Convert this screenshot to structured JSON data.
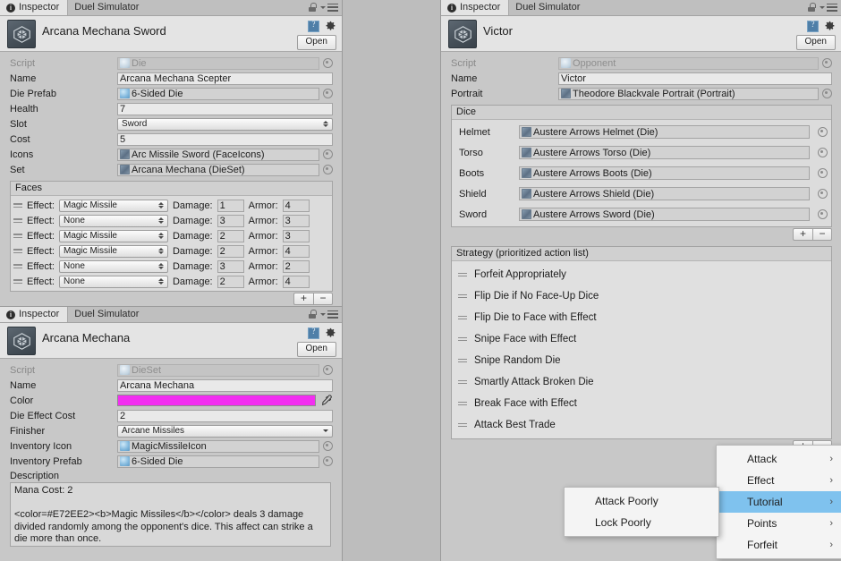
{
  "tabs": {
    "inspector": "Inspector",
    "duel_simulator": "Duel Simulator"
  },
  "common": {
    "open_label": "Open",
    "plus": "+",
    "minus": "−",
    "submenu_arrow": "›"
  },
  "panel_die": {
    "object_name": "Arcana Mechana Sword",
    "fields": [
      {
        "label": "Script",
        "value": "Die",
        "type": "object-disabled",
        "icon": "script-icon"
      },
      {
        "label": "Name",
        "value": "Arcana Mechana Scepter",
        "type": "text"
      },
      {
        "label": "Die Prefab",
        "value": "6-Sided Die",
        "type": "object",
        "icon": "die-icon"
      },
      {
        "label": "Health",
        "value": "7",
        "type": "text"
      },
      {
        "label": "Slot",
        "value": "Sword",
        "type": "enum"
      },
      {
        "label": "Cost",
        "value": "5",
        "type": "text"
      },
      {
        "label": "Icons",
        "value": "Arc Missile Sword (FaceIcons)",
        "type": "object",
        "icon": "texture-icon"
      },
      {
        "label": "Set",
        "value": "Arcana Mechana (DieSet)",
        "type": "object",
        "icon": "texture-icon"
      }
    ],
    "faces": {
      "title": "Faces",
      "col_effect": "Effect:",
      "col_damage": "Damage:",
      "col_armor": "Armor:",
      "rows": [
        {
          "effect": "Magic Missile",
          "damage": "1",
          "armor": "4"
        },
        {
          "effect": "None",
          "damage": "3",
          "armor": "3"
        },
        {
          "effect": "Magic Missile",
          "damage": "2",
          "armor": "3"
        },
        {
          "effect": "Magic Missile",
          "damage": "2",
          "armor": "4"
        },
        {
          "effect": "None",
          "damage": "3",
          "armor": "2"
        },
        {
          "effect": "None",
          "damage": "2",
          "armor": "4"
        }
      ]
    }
  },
  "panel_dieset": {
    "object_name": "Arcana Mechana",
    "fields": [
      {
        "label": "Script",
        "value": "DieSet",
        "type": "object-disabled",
        "icon": "script-icon"
      },
      {
        "label": "Name",
        "value": "Arcana Mechana",
        "type": "text"
      },
      {
        "label": "Color",
        "value": "#F22EF0",
        "type": "color"
      },
      {
        "label": "Die Effect Cost",
        "value": "2",
        "type": "text"
      },
      {
        "label": "Finisher",
        "value": "Arcane Missiles",
        "type": "dropdown"
      },
      {
        "label": "Inventory Icon",
        "value": "MagicMissileIcon",
        "type": "object",
        "icon": "die-icon"
      },
      {
        "label": "Inventory Prefab",
        "value": "6-Sided Die",
        "type": "object",
        "icon": "die-icon"
      }
    ],
    "description_label": "Description",
    "description_text": "Mana Cost: 2\n\n<color=#E72EE2><b>Magic Missiles</b></color> deals 3 damage divided randomly among the opponent's dice. This affect can strike a die more than once."
  },
  "panel_opponent": {
    "object_name": "Victor",
    "fields": [
      {
        "label": "Script",
        "value": "Opponent",
        "type": "object-disabled",
        "icon": "script-icon"
      },
      {
        "label": "Name",
        "value": "Victor",
        "type": "text"
      },
      {
        "label": "Portrait",
        "value": "Theodore Blackvale Portrait (Portrait)",
        "type": "object",
        "icon": "texture-icon"
      }
    ],
    "dice": {
      "title": "Dice",
      "rows": [
        {
          "label": "Helmet",
          "value": "Austere Arrows Helmet (Die)"
        },
        {
          "label": "Torso",
          "value": "Austere Arrows Torso (Die)"
        },
        {
          "label": "Boots",
          "value": "Austere Arrows Boots (Die)"
        },
        {
          "label": "Shield",
          "value": "Austere Arrows Shield (Die)"
        },
        {
          "label": "Sword",
          "value": "Austere Arrows Sword (Die)"
        }
      ]
    },
    "strategy": {
      "title": "Strategy (prioritized action list)",
      "items": [
        "Forfeit Appropriately",
        "Flip Die if No Face-Up Dice",
        "Flip Die to Face with Effect",
        "Snipe Face with Effect",
        "Snipe Random Die",
        "Smartly Attack Broken Die",
        "Break Face with Effect",
        "Attack Best Trade"
      ]
    }
  },
  "context_menu": {
    "items": [
      {
        "label": "Attack",
        "selected": false
      },
      {
        "label": "Effect",
        "selected": false
      },
      {
        "label": "Tutorial",
        "selected": true
      },
      {
        "label": "Points",
        "selected": false
      },
      {
        "label": "Forfeit",
        "selected": false
      }
    ],
    "submenu_items": [
      {
        "label": "Attack Poorly"
      },
      {
        "label": "Lock Poorly"
      }
    ],
    "highlight_color": "#7FC2EE"
  }
}
